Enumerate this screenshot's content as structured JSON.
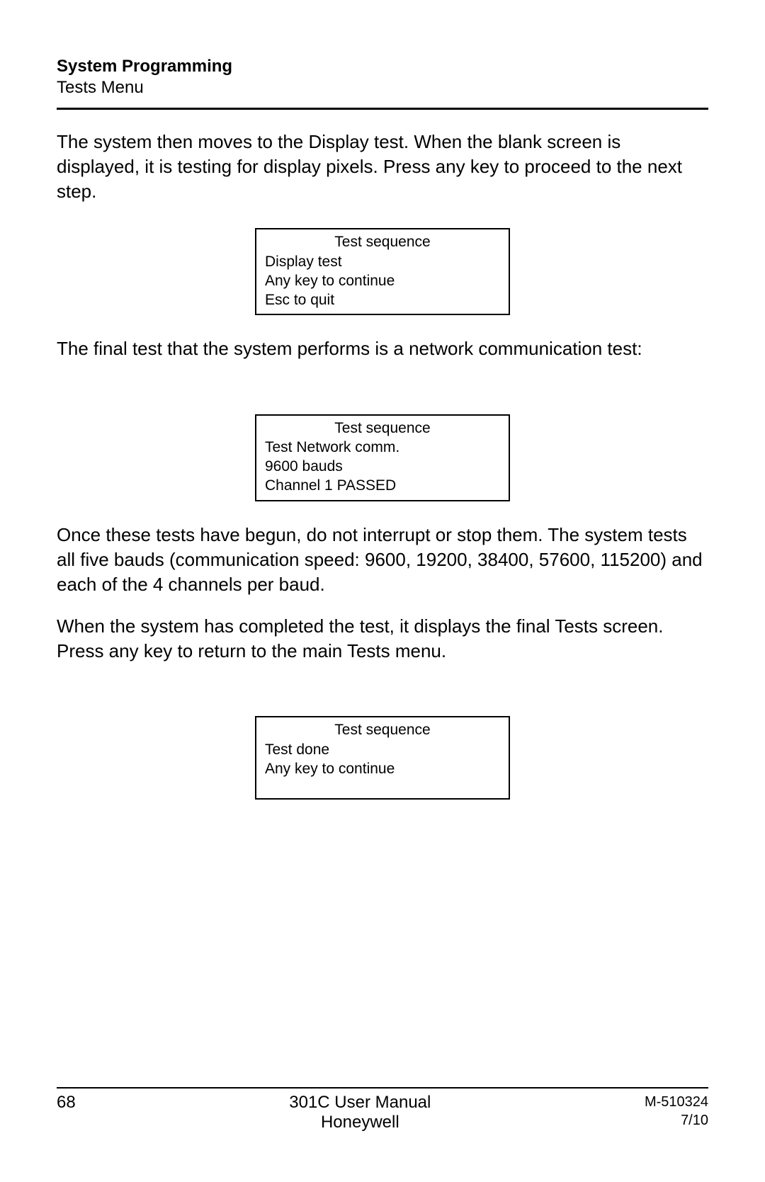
{
  "header": {
    "title": "System Programming",
    "subtitle": "Tests Menu"
  },
  "para1": "The system then moves to the Display test.  When the blank screen is displayed, it is testing for display pixels. Press any key to proceed to the next step.",
  "box1": {
    "title": "Test sequence",
    "line1": "Display test",
    "line2": "Any key to continue",
    "line3": "Esc to quit"
  },
  "para2": "The final test that the system performs is a network communication test:",
  "box2": {
    "title": "Test sequence",
    "line1": "Test Network comm.",
    "line2": "9600 bauds",
    "line3": "Channel 1 PASSED"
  },
  "para3": "Once these tests have begun, do not interrupt or stop them.  The system tests all five bauds (communication speed: 9600, 19200, 38400, 57600, 115200) and each of the 4 channels per baud.",
  "para4": "When the system has completed the test, it displays the final Tests screen. Press any key to return to the main Tests menu.",
  "box3": {
    "title": "Test sequence",
    "line1": "Test done",
    "line2": "Any key to continue"
  },
  "footer": {
    "page": "68",
    "center1": "301C User Manual",
    "center2": "Honeywell",
    "right1": "M-510324",
    "right2": "7/10"
  }
}
